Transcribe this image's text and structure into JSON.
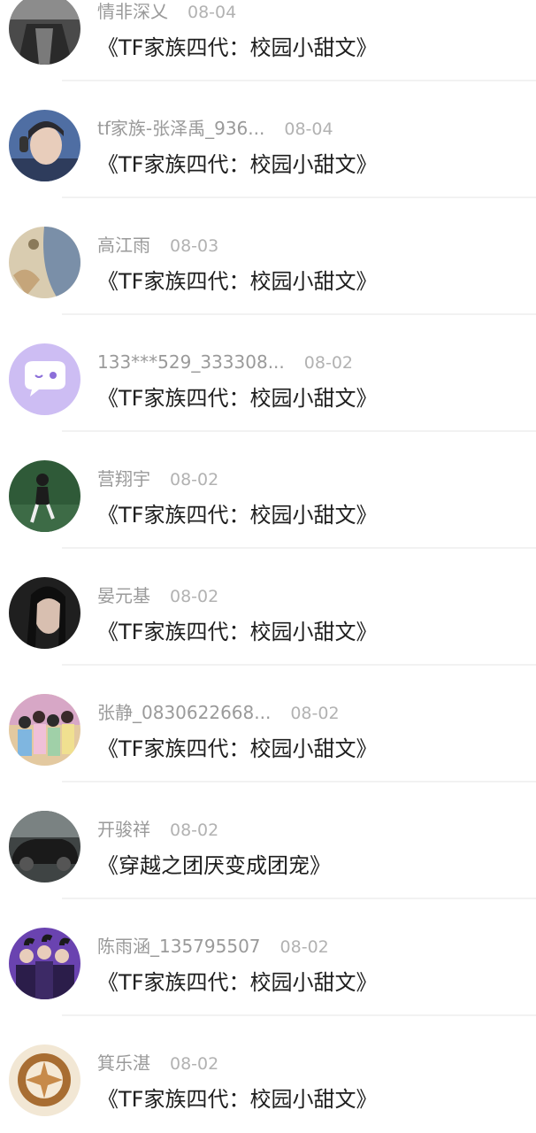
{
  "comments": [
    {
      "name": "情非深乂",
      "date": "08-04",
      "title": "《TF家族四代：校园小甜文》",
      "avatar_color": "#6b6b6b",
      "avatar_icon": "person-photo-icon"
    },
    {
      "name": "tf家族-张泽禹_936...",
      "date": "08-04",
      "title": "《TF家族四代：校园小甜文》",
      "avatar_color": "#3d4a66",
      "avatar_icon": "person-photo-icon"
    },
    {
      "name": "高江雨",
      "date": "08-03",
      "title": "《TF家族四代：校园小甜文》",
      "avatar_color": "#b7a68a",
      "avatar_icon": "artwork-icon"
    },
    {
      "name": "133***529_333308...",
      "date": "08-02",
      "title": "《TF家族四代：校园小甜文》",
      "avatar_color": "#c9b8f3",
      "avatar_icon": "chat-bubble-icon"
    },
    {
      "name": "营翔宇",
      "date": "08-02",
      "title": "《TF家族四代：校园小甜文》",
      "avatar_color": "#2e5a3a",
      "avatar_icon": "person-photo-icon"
    },
    {
      "name": "晏元基",
      "date": "08-02",
      "title": "《TF家族四代：校园小甜文》",
      "avatar_color": "#2b2b2b",
      "avatar_icon": "person-photo-icon"
    },
    {
      "name": "张静_0830622668...",
      "date": "08-02",
      "title": "《TF家族四代：校园小甜文》",
      "avatar_color": "#c99ab8",
      "avatar_icon": "group-photo-icon"
    },
    {
      "name": "开骏祥",
      "date": "08-02",
      "title": "《穿越之团厌变成团宠》",
      "avatar_color": "#3a3f3f",
      "avatar_icon": "car-icon"
    },
    {
      "name": "陈雨涵_135795507",
      "date": "08-02",
      "title": "《TF家族四代：校园小甜文》",
      "avatar_color": "#5a3b8c",
      "avatar_icon": "group-photo-icon"
    },
    {
      "name": "箕乐湛",
      "date": "08-02",
      "title": "《TF家族四代：校园小甜文》",
      "avatar_color": "#a87a3f",
      "avatar_icon": "latte-art-icon"
    }
  ]
}
